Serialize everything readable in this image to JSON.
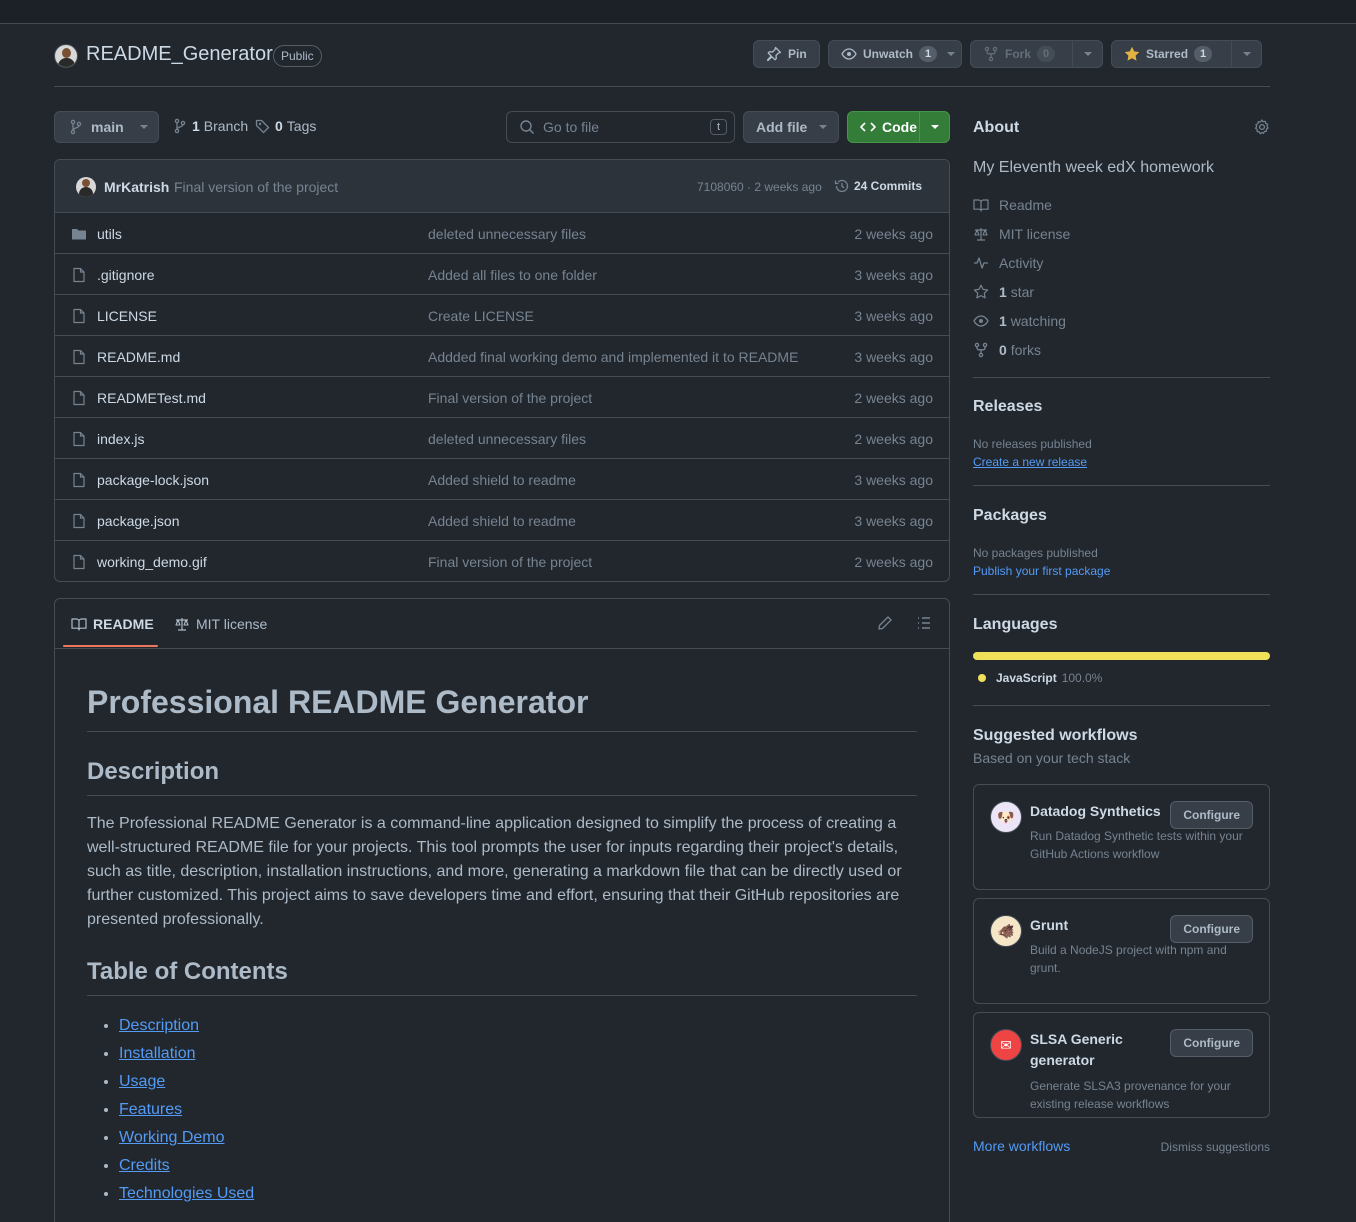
{
  "repo": {
    "name": "README_Generator",
    "visibility": "Public",
    "pin_label": "Pin",
    "unwatch_label": "Unwatch",
    "watch_count": "1",
    "fork_label": "Fork",
    "fork_count": "0",
    "starred_label": "Starred",
    "star_count": "1"
  },
  "toolbar": {
    "branch": "main",
    "branch_count": "1",
    "branch_label": "Branch",
    "tag_count": "0",
    "tag_label": "Tags",
    "search_placeholder": "Go to file",
    "search_kbd": "t",
    "add_file_label": "Add file",
    "code_label": "Code"
  },
  "latest_commit": {
    "author": "MrKatrish",
    "message": "Final version of the project",
    "hash_time": "7108060 · 2 weeks ago",
    "commits_label": "24 Commits"
  },
  "files": [
    {
      "name": "utils",
      "type": "folder",
      "message": "deleted unnecessary files",
      "date": "2 weeks ago"
    },
    {
      "name": ".gitignore",
      "type": "file",
      "message": "Added all files to one folder",
      "date": "3 weeks ago"
    },
    {
      "name": "LICENSE",
      "type": "file",
      "message": "Create LICENSE",
      "date": "3 weeks ago"
    },
    {
      "name": "README.md",
      "type": "file",
      "message": "Addded final working demo and implemented it to README",
      "date": "3 weeks ago"
    },
    {
      "name": "READMETest.md",
      "type": "file",
      "message": "Final version of the project",
      "date": "2 weeks ago"
    },
    {
      "name": "index.js",
      "type": "file",
      "message": "deleted unnecessary files",
      "date": "2 weeks ago"
    },
    {
      "name": "package-lock.json",
      "type": "file",
      "message": "Added shield to readme",
      "date": "3 weeks ago"
    },
    {
      "name": "package.json",
      "type": "file",
      "message": "Added shield to readme",
      "date": "3 weeks ago"
    },
    {
      "name": "working_demo.gif",
      "type": "file",
      "message": "Final version of the project",
      "date": "2 weeks ago"
    }
  ],
  "readme": {
    "tab_readme": "README",
    "tab_license": "MIT license",
    "title": "Professional README Generator",
    "h_description": "Description",
    "description": "The Professional README Generator is a command-line application designed to simplify the process of creating a well-structured README file for your projects. This tool prompts the user for inputs regarding their project's details, such as title, description, installation instructions, and more, generating a markdown file that can be directly used or further customized. This project aims to save developers time and effort, ensuring that their GitHub repositories are presented professionally.",
    "h_toc": "Table of Contents",
    "toc": [
      "Description",
      "Installation",
      "Usage",
      "Features",
      "Working Demo",
      "Credits",
      "Technologies Used"
    ]
  },
  "about": {
    "title": "About",
    "description": "My Eleventh week edX homework",
    "readme": "Readme",
    "license": "MIT license",
    "activity": "Activity",
    "stars_count": "1",
    "stars_label": "star",
    "watching_count": "1",
    "watching_label": "watching",
    "forks_count": "0",
    "forks_label": "forks"
  },
  "releases": {
    "title": "Releases",
    "none": "No releases published",
    "link": "Create a new release"
  },
  "packages": {
    "title": "Packages",
    "none": "No packages published",
    "link": "Publish your first package"
  },
  "languages": {
    "title": "Languages",
    "name": "JavaScript",
    "percent": "100.0%",
    "percent_value": 100,
    "color": "#f1e05a"
  },
  "workflows": {
    "title": "Suggested workflows",
    "subtitle": "Based on your tech stack",
    "configure_label": "Configure",
    "items": [
      {
        "name": "Datadog Synthetics",
        "desc": "Run Datadog Synthetic tests within your GitHub Actions workflow",
        "icon": "datadog-icon"
      },
      {
        "name": "Grunt",
        "desc": "Build a NodeJS project with npm and grunt.",
        "icon": "grunt-icon"
      },
      {
        "name": "SLSA Generic generator",
        "desc": "Generate SLSA3 provenance for your existing release workflows",
        "icon": "slsa-icon"
      }
    ],
    "more": "More workflows",
    "dismiss": "Dismiss suggestions"
  },
  "colors": {
    "background": "#22272e",
    "border": "#444c56",
    "accent_green": "#347d39",
    "link": "#539bf5",
    "tab_underline": "#ec775c"
  }
}
